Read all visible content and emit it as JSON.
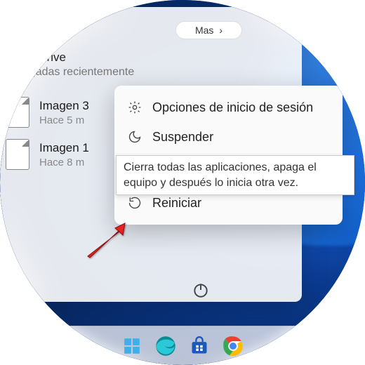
{
  "more_button": "Mas",
  "section": {
    "title": "oogle Drive",
    "subtitle": "Agregadas recientemente"
  },
  "files": [
    {
      "name": "Imagen 3",
      "time": "Hace 5 m"
    },
    {
      "name": "Imagen 1",
      "time": "Hace 8 m"
    }
  ],
  "power_menu": {
    "signin_options": "Opciones de inicio de sesión",
    "sleep": "Suspender",
    "restart": "Reiniciar"
  },
  "tooltip": "Cierra todas las aplicaciones, apaga el equipo y después lo inicia otra vez."
}
